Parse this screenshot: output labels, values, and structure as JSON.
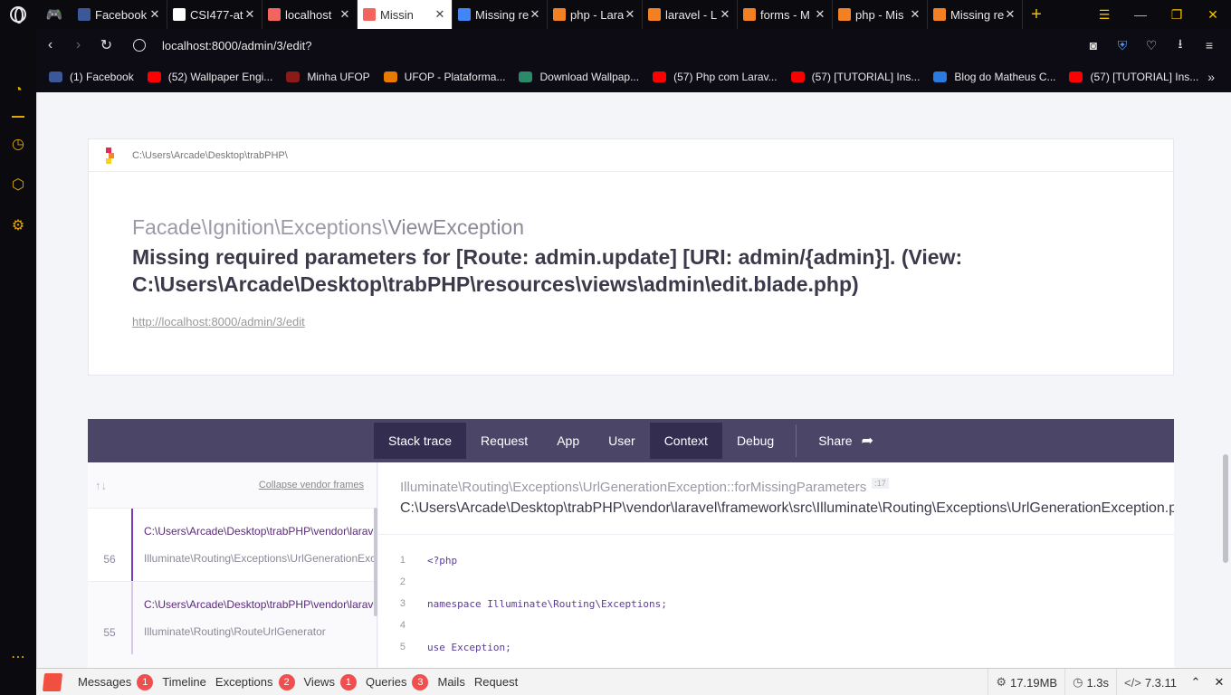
{
  "browser": {
    "tabs": [
      {
        "title": "Facebook",
        "favicon": "facebook-icon",
        "color": "#3b5998"
      },
      {
        "title": "CSI477-at",
        "favicon": "document-icon",
        "color": "#ffffff"
      },
      {
        "title": "localhost",
        "favicon": "laravel-icon",
        "color": "#f4645f"
      },
      {
        "title": "Missin",
        "favicon": "laravel-icon",
        "color": "#f4645f",
        "active": true
      },
      {
        "title": "Missing re",
        "favicon": "google-icon",
        "color": "#4285f4"
      },
      {
        "title": "php - Lara",
        "favicon": "stackoverflow-icon",
        "color": "#f48024"
      },
      {
        "title": "laravel - L",
        "favicon": "stackoverflow-icon",
        "color": "#f48024"
      },
      {
        "title": "forms - M",
        "favicon": "stackoverflow-icon",
        "color": "#f48024"
      },
      {
        "title": "php - Mis",
        "favicon": "stackoverflow-icon",
        "color": "#f48024"
      },
      {
        "title": "Missing re",
        "favicon": "stackoverflow-icon",
        "color": "#f48024"
      }
    ],
    "url": "localhost:8000/admin/3/edit?",
    "bookmarks": [
      {
        "label": "(1) Facebook",
        "color": "#3b5998"
      },
      {
        "label": "(52) Wallpaper Engi...",
        "color": "#ff0000"
      },
      {
        "label": "Minha UFOP",
        "color": "#8b1a1a"
      },
      {
        "label": "UFOP - Plataforma...",
        "color": "#e87a00"
      },
      {
        "label": "Download Wallpap...",
        "color": "#2a8a6a"
      },
      {
        "label": "(57) Php com Larav...",
        "color": "#ff0000"
      },
      {
        "label": "(57) [TUTORIAL] Ins...",
        "color": "#ff0000"
      },
      {
        "label": "Blog do Matheus C...",
        "color": "#2a7be0"
      },
      {
        "label": "(57) [TUTORIAL] Ins...",
        "color": "#ff0000"
      }
    ]
  },
  "error": {
    "base_path": "C:\\Users\\Arcade\\Desktop\\trabPHP\\",
    "exception_namespace": "Facade\\Ignition\\Exceptions\\",
    "exception_name": "ViewException",
    "message": "Missing required parameters for [Route: admin.update] [URI: admin/{admin}]. (View: C:\\Users\\Arcade\\Desktop\\trabPHP\\resources\\views\\admin\\edit.blade.php)",
    "url": "http://localhost:8000/admin/3/edit"
  },
  "ignition_tabs": [
    "Stack trace",
    "Request",
    "App",
    "User",
    "Context",
    "Debug"
  ],
  "share_label": "Share",
  "frames": {
    "collapse_label": "Collapse vendor frames",
    "items": [
      {
        "path": "C:\\Users\\Arcade\\Desktop\\trabPHP\\vendor\\laravel",
        "class": "Illuminate\\Routing\\Exceptions\\UrlGenerationException",
        "line": "56"
      },
      {
        "path": "C:\\Users\\Arcade\\Desktop\\trabPHP\\vendor\\laravel",
        "class": "Illuminate\\Routing\\RouteUrlGenerator",
        "line": "55"
      }
    ]
  },
  "code": {
    "class_method": "Illuminate\\Routing\\Exceptions\\UrlGenerationException::forMissingParameters",
    "line_ref": ":17",
    "file": "C:\\Users\\Arcade\\Desktop\\trabPHP\\vendor\\laravel\\framework\\src\\Illuminate\\Routing\\Exceptions\\UrlGenerationException.php",
    "lines": [
      {
        "n": "1",
        "text": "<?php"
      },
      {
        "n": "2",
        "text": ""
      },
      {
        "n": "3",
        "text": "namespace Illuminate\\Routing\\Exceptions;"
      },
      {
        "n": "4",
        "text": ""
      },
      {
        "n": "5",
        "text": "use Exception;"
      }
    ]
  },
  "debugbar": {
    "items": [
      {
        "label": "Messages",
        "badge": "1"
      },
      {
        "label": "Timeline",
        "badge": ""
      },
      {
        "label": "Exceptions",
        "badge": "2"
      },
      {
        "label": "Views",
        "badge": "1"
      },
      {
        "label": "Queries",
        "badge": "3"
      },
      {
        "label": "Mails",
        "badge": ""
      },
      {
        "label": "Request",
        "badge": ""
      }
    ],
    "memory": "17.19MB",
    "time": "1.3s",
    "php": "7.3.11"
  }
}
